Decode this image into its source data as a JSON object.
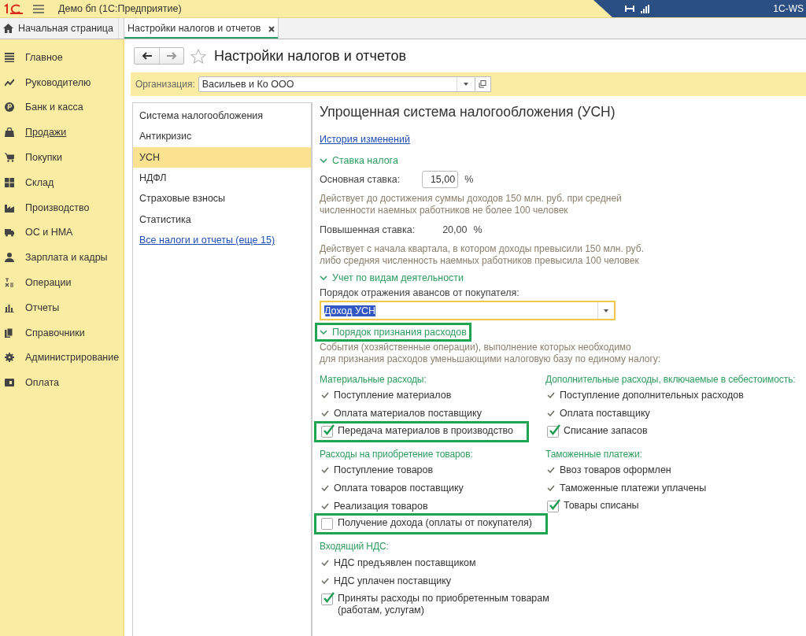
{
  "app": {
    "title": "Демо бп  (1С:Предприятие)",
    "server": "1C-WS"
  },
  "tabs": [
    {
      "label": "Начальная страница",
      "selected": false,
      "kind": "home"
    },
    {
      "label": "Настройки налогов и отчетов",
      "selected": true,
      "kind": "document"
    }
  ],
  "sidebar": {
    "items": [
      {
        "label": "Главное",
        "hovered": false
      },
      {
        "label": "Руководителю",
        "hovered": false
      },
      {
        "label": "Банк и касса",
        "hovered": false
      },
      {
        "label": "Продажи",
        "hovered": true
      },
      {
        "label": "Покупки",
        "hovered": false
      },
      {
        "label": "Склад",
        "hovered": false
      },
      {
        "label": "Производство",
        "hovered": false
      },
      {
        "label": "ОС и НМА",
        "hovered": false
      },
      {
        "label": "Зарплата и кадры",
        "hovered": false
      },
      {
        "label": "Операции",
        "hovered": false
      },
      {
        "label": "Отчеты",
        "hovered": false
      },
      {
        "label": "Справочники",
        "hovered": false
      },
      {
        "label": "Администрирование",
        "hovered": false
      },
      {
        "label": "Оплата",
        "hovered": false
      }
    ]
  },
  "form": {
    "title": "Настройки налогов и отчетов",
    "organization": {
      "label": "Организация:",
      "value": "Васильев и Ко ООО"
    },
    "sections": [
      {
        "label": "Система налогообложения",
        "selected": false,
        "kind": "item"
      },
      {
        "label": "Антикризис",
        "selected": false,
        "kind": "item"
      },
      {
        "label": "УСН",
        "selected": true,
        "kind": "item"
      },
      {
        "label": "НДФЛ",
        "selected": false,
        "kind": "item"
      },
      {
        "label": "Страховые взносы",
        "selected": false,
        "kind": "item"
      },
      {
        "label": "Статистика",
        "selected": false,
        "kind": "item"
      },
      {
        "label": "Все налоги и отчеты (еще 15)",
        "selected": false,
        "kind": "link"
      }
    ],
    "panel": {
      "title": "Упрощенная система налогообложения (УСН)",
      "history_link": "История изменений",
      "tax_rate": {
        "header": "Ставка налога",
        "expanded": true,
        "highlighted": false,
        "base_label": "Основная ставка:",
        "base_value": "15,00",
        "base_unit": "%",
        "base_note": [
          "Действует до достижения суммы доходов 150 млн. руб. при средней",
          "численности наемных работников не более 100 человек"
        ],
        "raised_label": "Повышенная ставка:",
        "raised_value": "20,00",
        "raised_unit": "%",
        "raised_note": [
          "Действует с начала квартала, в котором доходы превысили 150 млн. руб.",
          "либо средняя численность наемных работников превысила 100 человек"
        ]
      },
      "activity": {
        "header": "Учет по видам деятельности",
        "expanded": true,
        "highlighted": false,
        "advance_label": "Порядок отражения авансов от покупателя:",
        "advance_value": "Доход УСН"
      },
      "expenses": {
        "header": "Порядок признания расходов",
        "expanded": true,
        "highlighted": true,
        "note": [
          "События (хозяйственные операции), выполнение которых необходимо",
          "для признания расходов уменьшающими налоговую базу по единому налогу:"
        ],
        "columns": [
          {
            "groups": [
              {
                "title": "Материальные расходы:",
                "items": [
                  {
                    "label": "Поступление материалов",
                    "kind": "fixed",
                    "highlighted": false
                  },
                  {
                    "label": "Оплата материалов поставщику",
                    "kind": "fixed",
                    "highlighted": false
                  },
                  {
                    "label": "Передача материалов в производство",
                    "kind": "checkbox",
                    "checked": true,
                    "highlighted": true
                  }
                ]
              },
              {
                "title": "Расходы на приобретение товаров:",
                "items": [
                  {
                    "label": "Поступление товаров",
                    "kind": "fixed",
                    "highlighted": false
                  },
                  {
                    "label": "Оплата товаров поставщику",
                    "kind": "fixed",
                    "highlighted": false
                  },
                  {
                    "label": "Реализация товаров",
                    "kind": "fixed",
                    "highlighted": false
                  },
                  {
                    "label": "Получение дохода (оплаты от покупателя)",
                    "kind": "checkbox",
                    "checked": false,
                    "highlighted": true
                  }
                ]
              },
              {
                "title": "Входящий НДС:",
                "items": [
                  {
                    "label": "НДС предъявлен поставщиком",
                    "kind": "fixed",
                    "highlighted": false
                  },
                  {
                    "label": "НДС уплачен поставщику",
                    "kind": "fixed",
                    "highlighted": false
                  },
                  {
                    "label": "Приняты расходы по приобретенным товарам (работам, услугам)",
                    "kind": "checkbox",
                    "checked": true,
                    "highlighted": false
                  }
                ]
              }
            ]
          },
          {
            "groups": [
              {
                "title": "Дополнительные расходы, включаемые в себестоимость:",
                "items": [
                  {
                    "label": "Поступление дополнительных расходов",
                    "kind": "fixed",
                    "highlighted": false
                  },
                  {
                    "label": "Оплата поставщику",
                    "kind": "fixed",
                    "highlighted": false
                  },
                  {
                    "label": "Списание запасов",
                    "kind": "checkbox",
                    "checked": true,
                    "highlighted": false
                  }
                ]
              },
              {
                "title": "Таможенные платежи:",
                "items": [
                  {
                    "label": "Ввоз товаров оформлен",
                    "kind": "fixed",
                    "highlighted": false
                  },
                  {
                    "label": "Таможенные платежи уплачены",
                    "kind": "fixed",
                    "highlighted": false
                  },
                  {
                    "label": "Товары списаны",
                    "kind": "checkbox",
                    "checked": true,
                    "highlighted": false
                  }
                ]
              }
            ]
          }
        ]
      }
    }
  }
}
